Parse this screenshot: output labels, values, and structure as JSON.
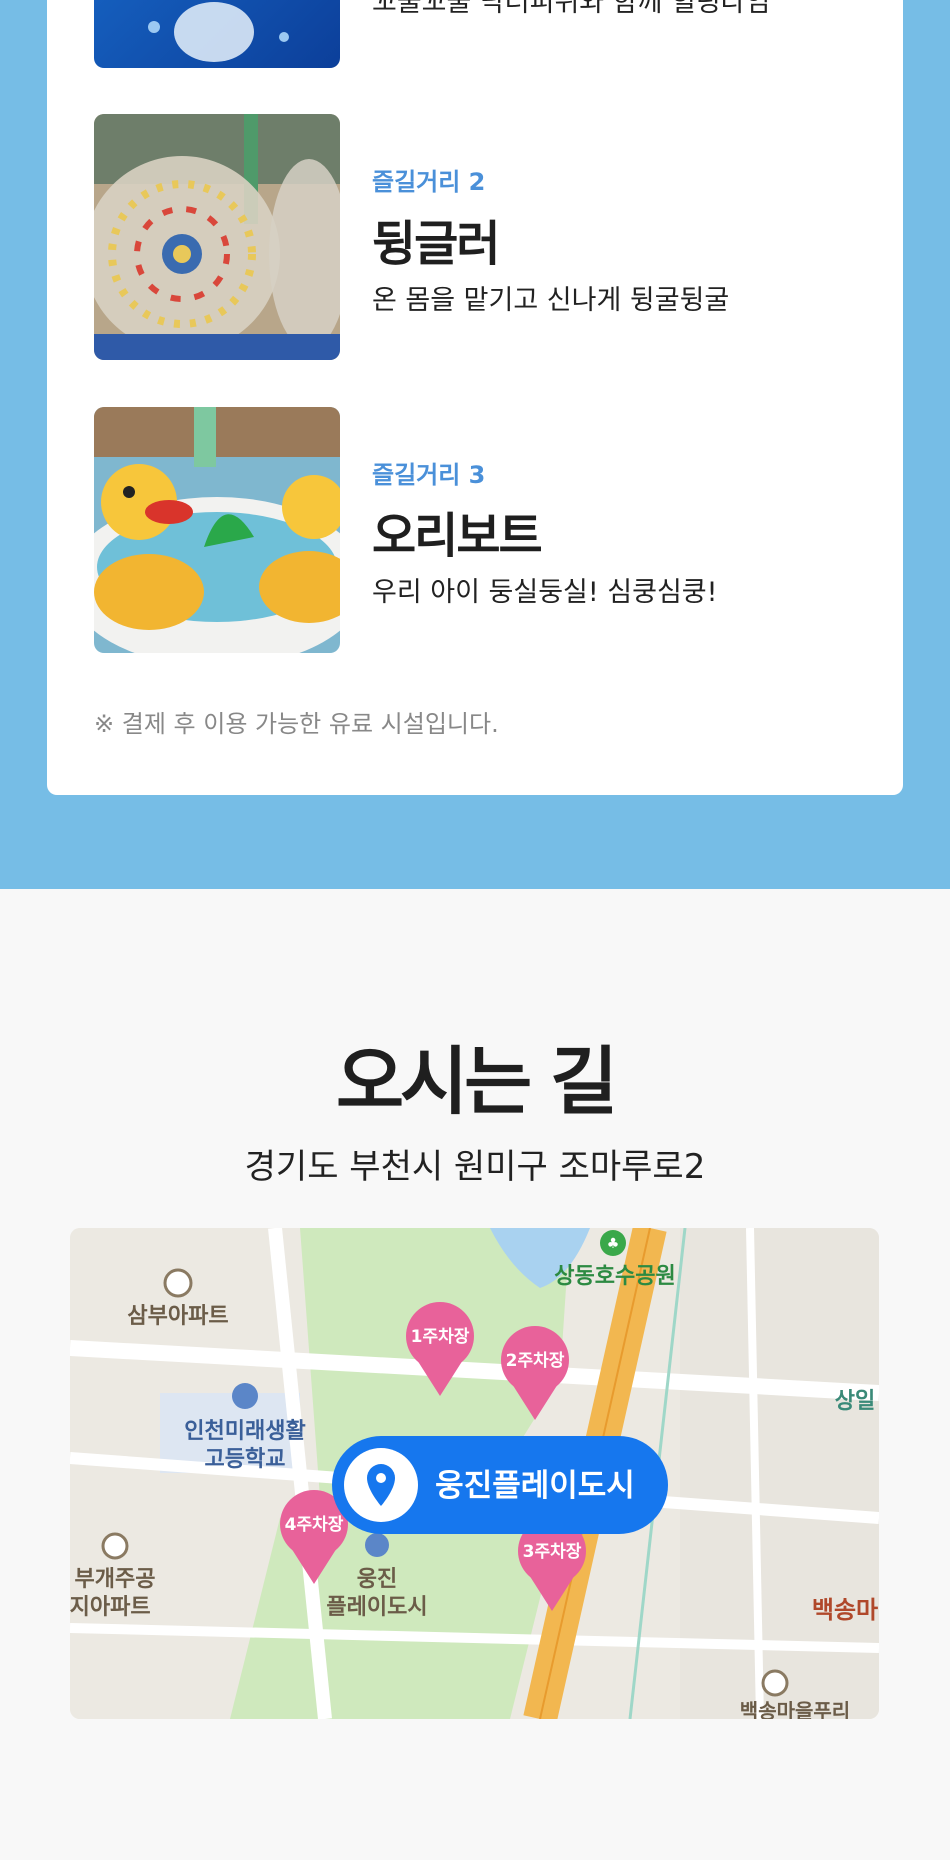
{
  "activities": [
    {
      "description": "꼬물꼬물 닥터피쉬와 함께 힐링타임"
    },
    {
      "tag": "즐길거리 2",
      "name": "뒹글러",
      "description": "온 몸을 맡기고 신나게 뒹굴뒹굴"
    },
    {
      "tag": "즐길거리 3",
      "name": "오리보트",
      "description": "우리 아이 둥실둥실! 심쿵심쿵!"
    }
  ],
  "note": "※ 결제 후 이용 가능한 유료 시설입니다.",
  "directions": {
    "title": "오시는 길",
    "address": "경기도 부천시 원미구 조마루로2"
  },
  "map": {
    "destination": "웅진플레이도시",
    "parking": [
      "1주차장",
      "2주차장",
      "3주차장",
      "4주차장"
    ],
    "labels": {
      "park": "상동호수공원",
      "apt1": "삼부아파트",
      "school1": "인천미래생활",
      "school2": "고등학교",
      "apt2a": "부개주공",
      "apt2b": "단지아파트",
      "poi1": "웅진",
      "poi2": "플레이도시",
      "sangil": "상일",
      "baeksong": "백송마",
      "baeksong2": "백송마을푸리"
    },
    "colors": {
      "pin": "#e8629a",
      "destination": "#1677ee",
      "road": "#f2b750",
      "park": "#cfe9bd"
    }
  }
}
